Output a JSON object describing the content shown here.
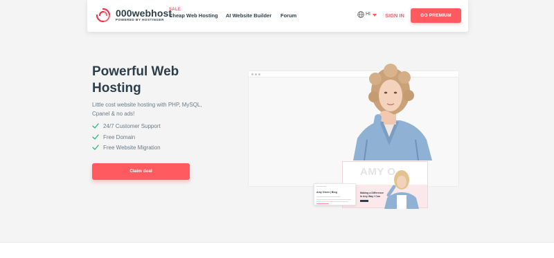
{
  "brand": {
    "name": "000webhost",
    "tagline": "POWERED BY HOSTINGER",
    "accent": "#ff5a5f",
    "dark": "#2c3e4a"
  },
  "nav": {
    "sale_badge": "SALE",
    "items": [
      {
        "label": "Cheap Web Hosting"
      },
      {
        "label": "AI Website Builder"
      },
      {
        "label": "Forum"
      }
    ],
    "lang": {
      "code": "HI",
      "icon": "globe-icon"
    },
    "signin": "SIGN IN",
    "premium": "GO PREMIUM"
  },
  "hero": {
    "title": "Powerful Web Hosting",
    "description": "Little cost website hosting with PHP, MySQL, Cpanel & no ads!",
    "features": [
      {
        "text": "24/7 Customer Support",
        "icon": "check-icon"
      },
      {
        "text": "Free Domain",
        "icon": "check-icon"
      },
      {
        "text": "Free Website Migration",
        "icon": "check-icon"
      }
    ],
    "cta": "Claim deal"
  },
  "illustration": {
    "blog_name": "AMY O",
    "blog_headline": "Making a Difference In Any Way I Can",
    "mini_title": "Amy Olsen | Blog"
  }
}
